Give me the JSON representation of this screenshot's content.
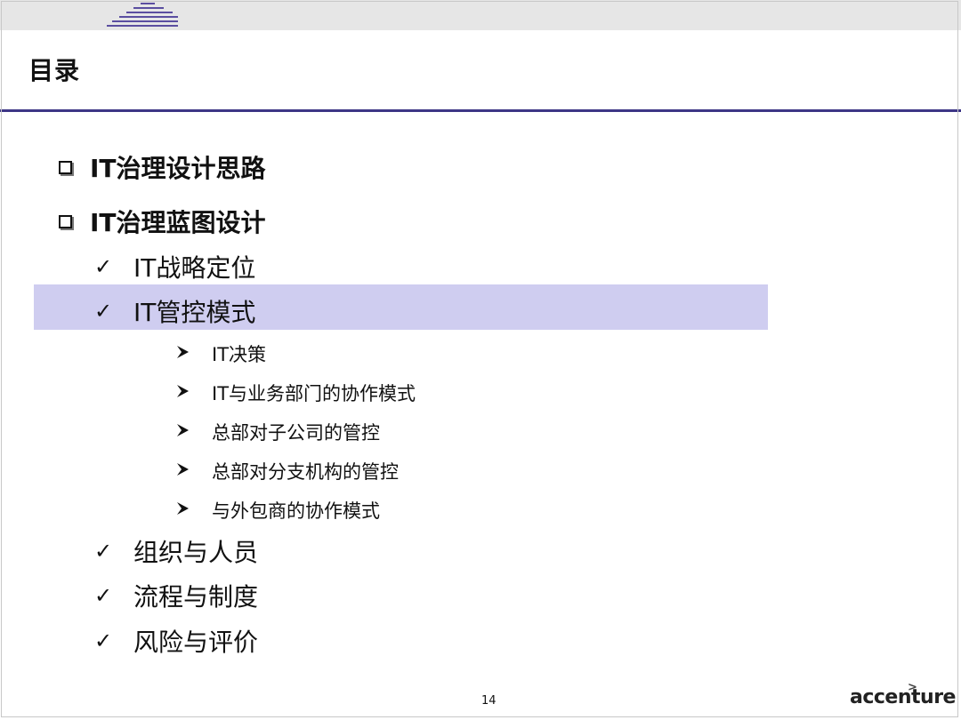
{
  "header": {
    "title": "目录"
  },
  "outline": {
    "sections": [
      {
        "label": "IT治理设计思路"
      },
      {
        "label": "IT治理蓝图设计"
      }
    ],
    "subsections": [
      {
        "label": "IT战略定位"
      },
      {
        "label": "IT管控模式"
      },
      {
        "label": "组织与人员"
      },
      {
        "label": "流程与制度"
      },
      {
        "label": "风险与评价"
      }
    ],
    "details": [
      {
        "label": "IT决策"
      },
      {
        "label": "IT与业务部门的协作模式"
      },
      {
        "label": "总部对子公司的管控"
      },
      {
        "label": "总部对分支机构的管控"
      },
      {
        "label": "与外包商的协作模式"
      }
    ],
    "highlight_color": "#cfcdf0"
  },
  "footer": {
    "page_number": "14",
    "brand": "accenture"
  },
  "colors": {
    "accent": "#3d3686",
    "logo_lines": "#5b4ea0"
  }
}
